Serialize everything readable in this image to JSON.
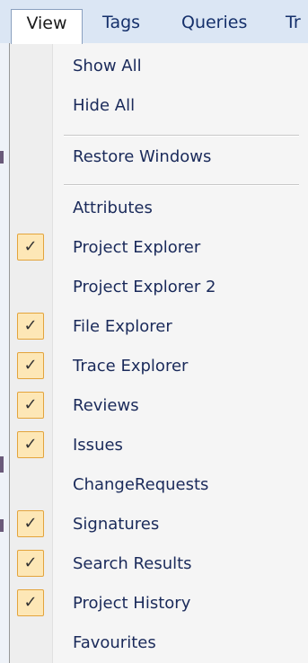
{
  "menubar": {
    "items": [
      "View",
      "Tags",
      "Queries",
      "Tr"
    ]
  },
  "view_menu": {
    "items": [
      {
        "label": "Show All",
        "checked": false
      },
      {
        "label": "Hide All",
        "checked": false
      },
      {
        "label": "Restore Windows",
        "checked": false
      },
      {
        "label": "Attributes",
        "checked": false
      },
      {
        "label": "Project Explorer",
        "checked": true
      },
      {
        "label": "Project Explorer 2",
        "checked": false
      },
      {
        "label": "File Explorer",
        "checked": true
      },
      {
        "label": "Trace Explorer",
        "checked": true
      },
      {
        "label": "Reviews",
        "checked": true
      },
      {
        "label": "Issues",
        "checked": true
      },
      {
        "label": "ChangeRequests",
        "checked": false
      },
      {
        "label": "Signatures",
        "checked": true
      },
      {
        "label": "Search Results",
        "checked": true
      },
      {
        "label": "Project History",
        "checked": true
      },
      {
        "label": "Favourites",
        "checked": false
      }
    ],
    "check_glyph": "✓",
    "check_icon": "checkmark-icon"
  },
  "colors": {
    "menubar_bg": "#dbe6f4",
    "menu_bg": "#f5f5f5",
    "check_bg": "#fde7b6",
    "check_border": "#e3a43c",
    "text": "#1a2a5a"
  }
}
